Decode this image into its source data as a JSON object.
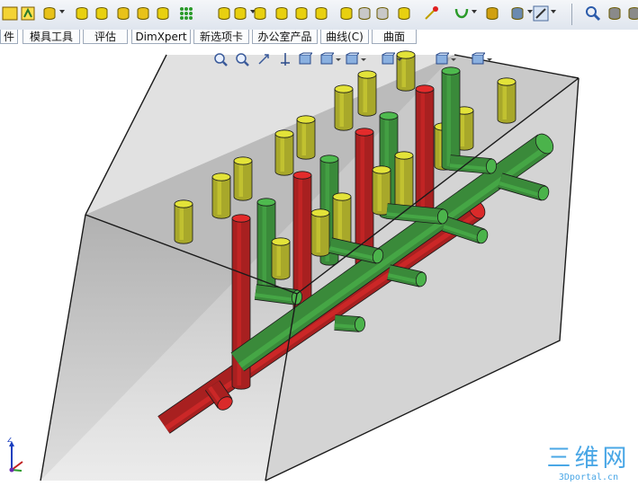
{
  "tabs": [
    "件",
    "模具工具",
    "评估",
    "DimXpert",
    "新选项卡",
    "办公室产品",
    "曲线(C)",
    "曲面"
  ],
  "triad_axis_label": "Z",
  "watermark": {
    "title": "三维网",
    "subtitle": "3Dportal.cn"
  },
  "colors": {
    "red_pipe": "#a82020",
    "green_pipe": "#3a8a3a",
    "yellow_pin": "#a8a82a",
    "block": "#9a9a9a"
  },
  "toolbar_icons": [
    "feature-icon",
    "sketch-icon",
    "extrude-icon",
    "revolve-icon",
    "sweep-icon",
    "loft-icon",
    "boundary-icon",
    "fillet-icon",
    "pattern-icon",
    "rib-icon",
    "draft-icon",
    "shell-icon",
    "wrap-icon",
    "dome-icon",
    "mirror-icon",
    "intersect-icon",
    "split-icon",
    "move-copy-icon",
    "combine-icon",
    "cut-icon",
    "curves-icon",
    "reference-geometry-icon",
    "instant3d-icon",
    "options-icon",
    "zoom-icon",
    "list-icon",
    "cube-icon"
  ],
  "hud_icons": [
    "zoom-to-fit-icon",
    "zoom-to-area-icon",
    "previous-view-icon",
    "section-view-icon",
    "view-orientation-icon",
    "display-style-icon",
    "hide-show-icon",
    "edit-appearance-icon",
    "apply-scene-icon",
    "view-settings-icon"
  ]
}
